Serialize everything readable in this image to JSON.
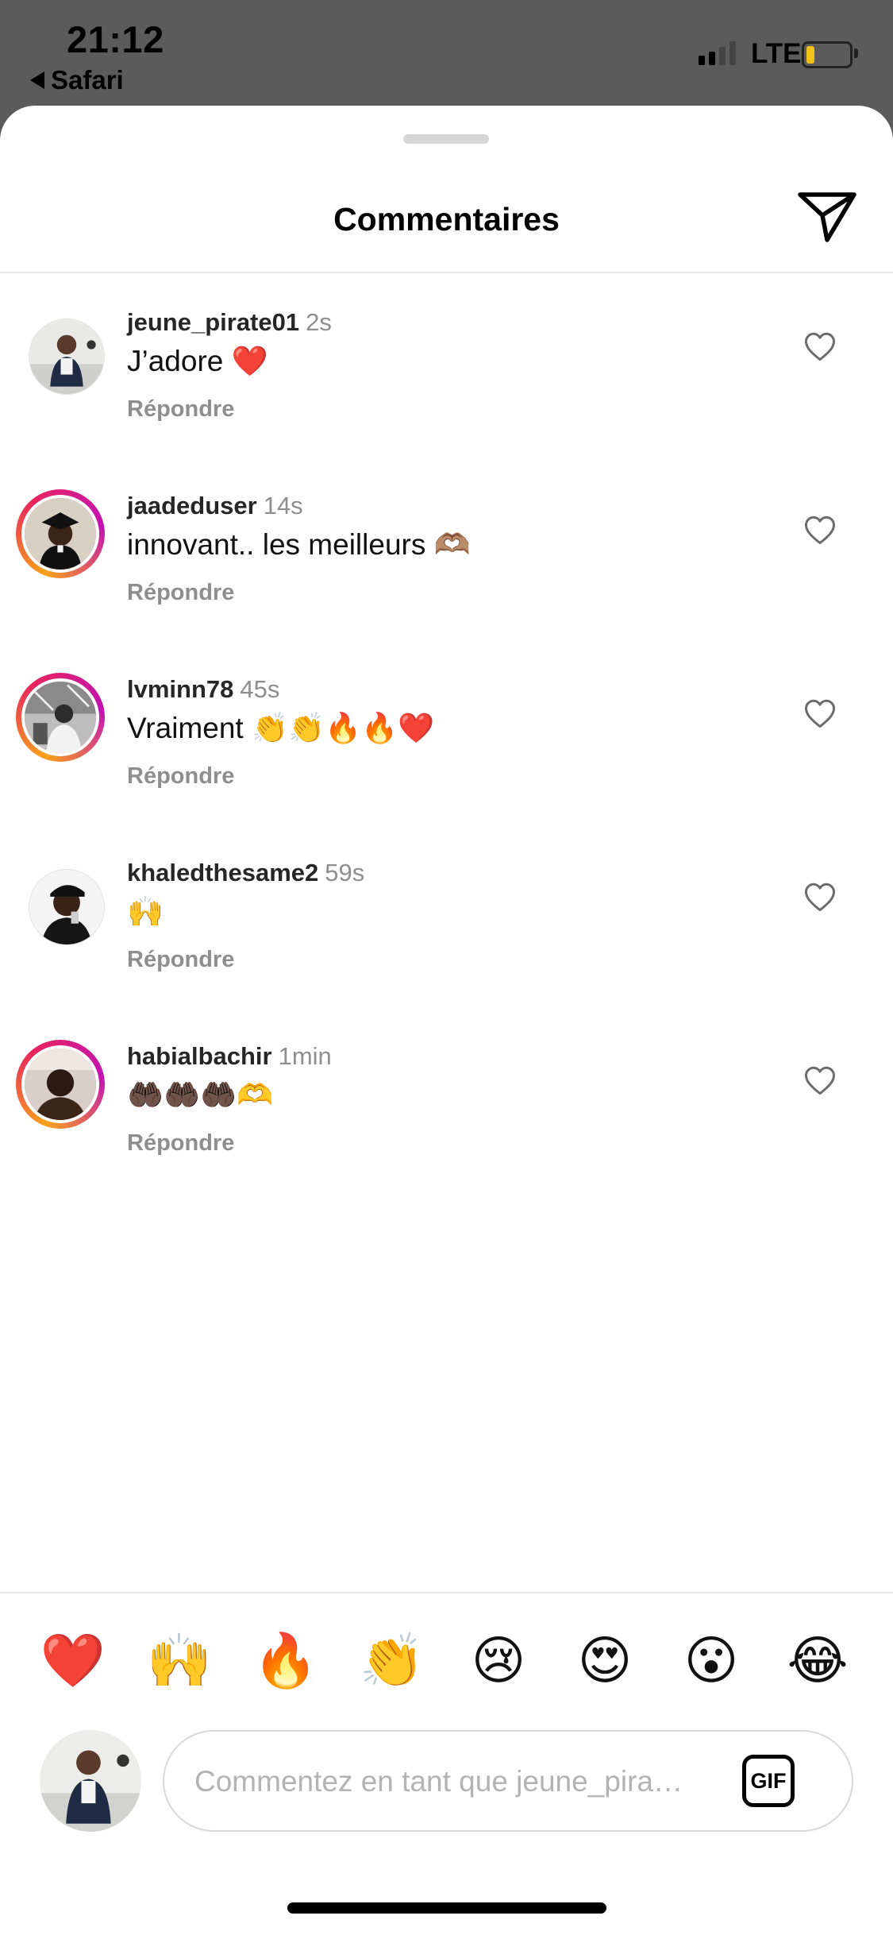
{
  "status_bar": {
    "time": "21:12",
    "back_app": "Safari",
    "network": "LTE",
    "battery_level": 0.2
  },
  "sheet": {
    "title": "Commentaires"
  },
  "comments": [
    {
      "username": "jeune_pirate01",
      "time": "2s",
      "text": "J’adore ❤️",
      "reply_label": "Répondre",
      "story_ring": false
    },
    {
      "username": "jaadeduser",
      "time": "14s",
      "text": "innovant.. les meilleurs 🫶🏽",
      "reply_label": "Répondre",
      "story_ring": true
    },
    {
      "username": "lvminn78",
      "time": "45s",
      "text": "Vraiment 👏👏🔥🔥❤️",
      "reply_label": "Répondre",
      "story_ring": true
    },
    {
      "username": "khaledthesame2",
      "time": "59s",
      "text": "🙌",
      "reply_label": "Répondre",
      "story_ring": false
    },
    {
      "username": "habialbachir",
      "time": "1min",
      "text": "🤲🏿🤲🏿🤲🏿🫶",
      "reply_label": "Répondre",
      "story_ring": true
    }
  ],
  "quick_emojis": [
    "❤️",
    "🙌",
    "🔥",
    "👏",
    "😢",
    "😍",
    "😮",
    "😂"
  ],
  "composer": {
    "placeholder": "Commentez en tant que jeune_pira…",
    "gif_label": "GIF"
  },
  "icons": {
    "send": "paper-plane-icon",
    "like": "heart-outline-icon",
    "back": "back-arrow-icon"
  },
  "colors": {
    "story_ring": [
      "#f8a21b",
      "#e8245f",
      "#c313b2"
    ],
    "muted_text": "#8e8e8e",
    "battery": "#f2c21b"
  }
}
